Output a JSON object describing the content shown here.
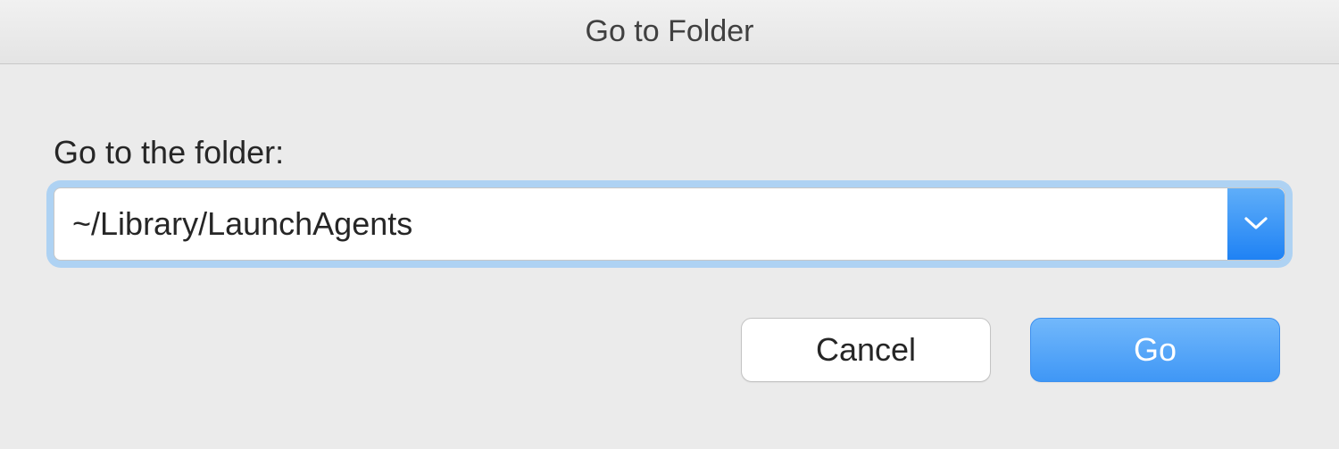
{
  "dialog": {
    "title": "Go to Folder",
    "label": "Go to the folder:",
    "path_value": "~/Library/LaunchAgents",
    "cancel_label": "Cancel",
    "go_label": "Go"
  }
}
